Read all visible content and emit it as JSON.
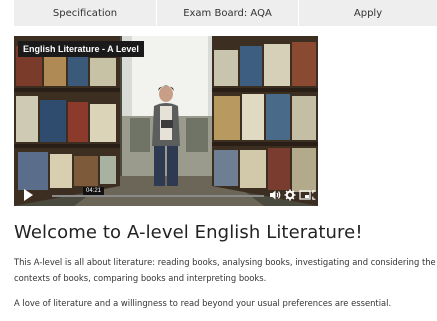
{
  "tabs": [
    {
      "label": "Specification"
    },
    {
      "label": "Exam Board: AQA"
    },
    {
      "label": "Apply"
    }
  ],
  "video": {
    "title": "English Literature - A Level",
    "timestamp": "04:21",
    "progress": 0.02
  },
  "content": {
    "heading": "Welcome to A-level English Literature!",
    "para1": "This A-level is all about literature: reading books, analysing books, investigating and considering the contexts of books, comparing books and interpreting books.",
    "para2": "A love of literature and a willingness to read beyond your usual preferences are essential."
  }
}
